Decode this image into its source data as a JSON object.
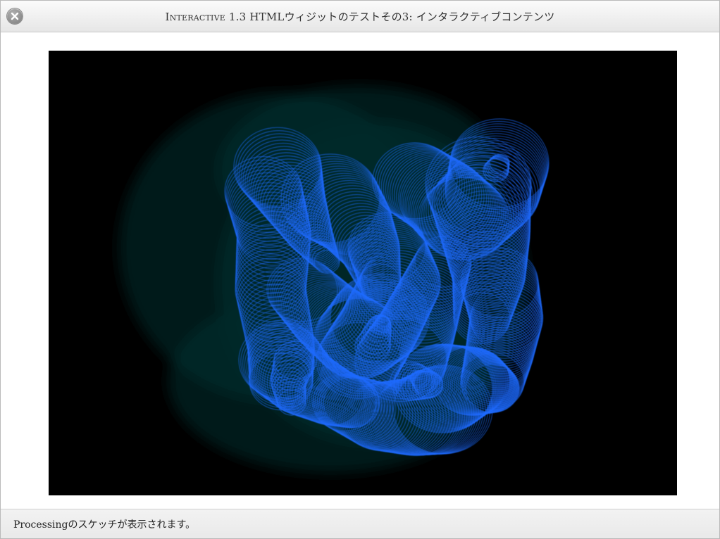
{
  "window": {
    "title_smallcaps": "Interactive 1.3",
    "title_rest": " HTMLウィジットのテストその3: インタラクティブコンテンツ",
    "close_icon": "close-icon"
  },
  "sketch": {
    "background_color": "#000000",
    "stroke_color": "#1e6bff",
    "glow_color": "#04302f"
  },
  "footer": {
    "caption": "Processingのスケッチが表示されます。"
  }
}
